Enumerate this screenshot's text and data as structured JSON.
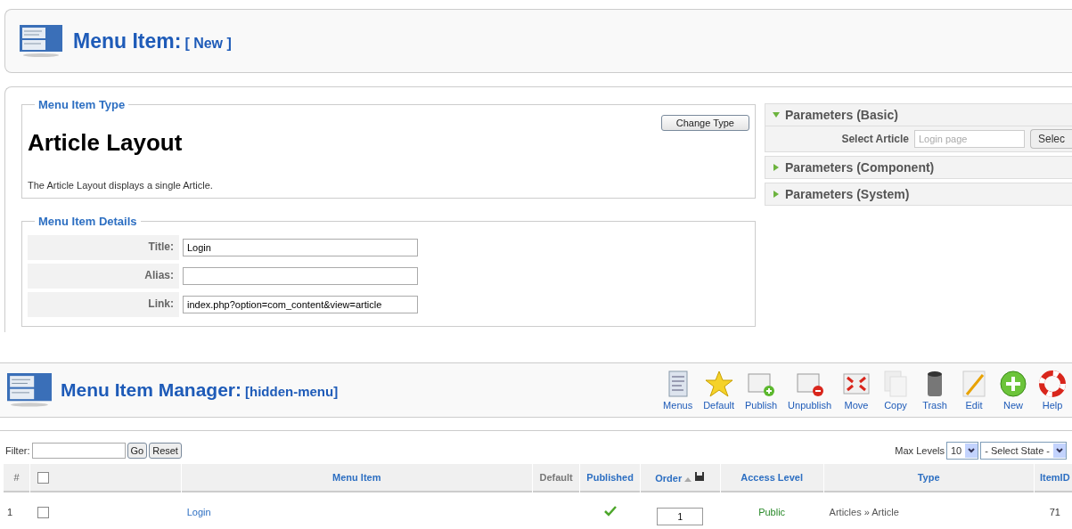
{
  "header": {
    "title": "Menu Item:",
    "subtitle": "[ New ]"
  },
  "menu_item_type": {
    "legend": "Menu Item Type",
    "button": "Change Type",
    "heading": "Article Layout",
    "description": "The Article Layout displays a single Article."
  },
  "menu_item_details": {
    "legend": "Menu Item Details",
    "fields": [
      {
        "label": "Title:",
        "value": "Login"
      },
      {
        "label": "Alias:"
      },
      {
        "label": "Link:",
        "value": "index.php?option=com_content&view=article"
      }
    ]
  },
  "parameters": [
    {
      "title": "Parameters (Basic)",
      "expanded": true,
      "fields": [
        {
          "label": "Select Article",
          "value": "Login page",
          "button": "Selec"
        }
      ]
    },
    {
      "title": "Parameters (Component)",
      "expanded": false
    },
    {
      "title": "Parameters (System)",
      "expanded": false
    }
  ],
  "manager": {
    "title": "Menu Item Manager:",
    "subtitle": "[hidden-menu]",
    "toolbar": [
      {
        "kind": "menus",
        "label": "Menus"
      },
      {
        "kind": "default",
        "label": "Default"
      },
      {
        "kind": "publish",
        "label": "Publish"
      },
      {
        "kind": "unpublish",
        "label": "Unpublish"
      },
      {
        "kind": "move",
        "label": "Move"
      },
      {
        "kind": "copy",
        "label": "Copy"
      },
      {
        "kind": "trash",
        "label": "Trash"
      },
      {
        "kind": "edit",
        "label": "Edit"
      },
      {
        "kind": "new",
        "label": "New"
      },
      {
        "kind": "help",
        "label": "Help"
      }
    ]
  },
  "filter": {
    "label": "Filter:",
    "buttons": [
      "Go",
      "Reset"
    ],
    "max_levels_label": "Max Levels",
    "max_levels": "10",
    "state": "- Select State -"
  },
  "table": {
    "columns": [
      {
        "kind": "number",
        "label": "#"
      },
      {
        "kind": "checkbox",
        "checked": false
      },
      {
        "kind": "link",
        "label": "Menu Item"
      },
      {
        "kind": "plain",
        "label": "Default"
      },
      {
        "kind": "link",
        "label": "Published"
      },
      {
        "kind": "order",
        "label": "Order"
      },
      {
        "kind": "link",
        "label": "Access Level"
      },
      {
        "kind": "link",
        "label": "Type"
      },
      {
        "kind": "link",
        "label": "ItemID"
      }
    ],
    "rows": [
      {
        "number": "1",
        "checked": false,
        "menu_item": "Login",
        "published": true,
        "order": "1",
        "access_level": "Public",
        "type": "Articles » Article",
        "item_id": "71"
      }
    ]
  }
}
